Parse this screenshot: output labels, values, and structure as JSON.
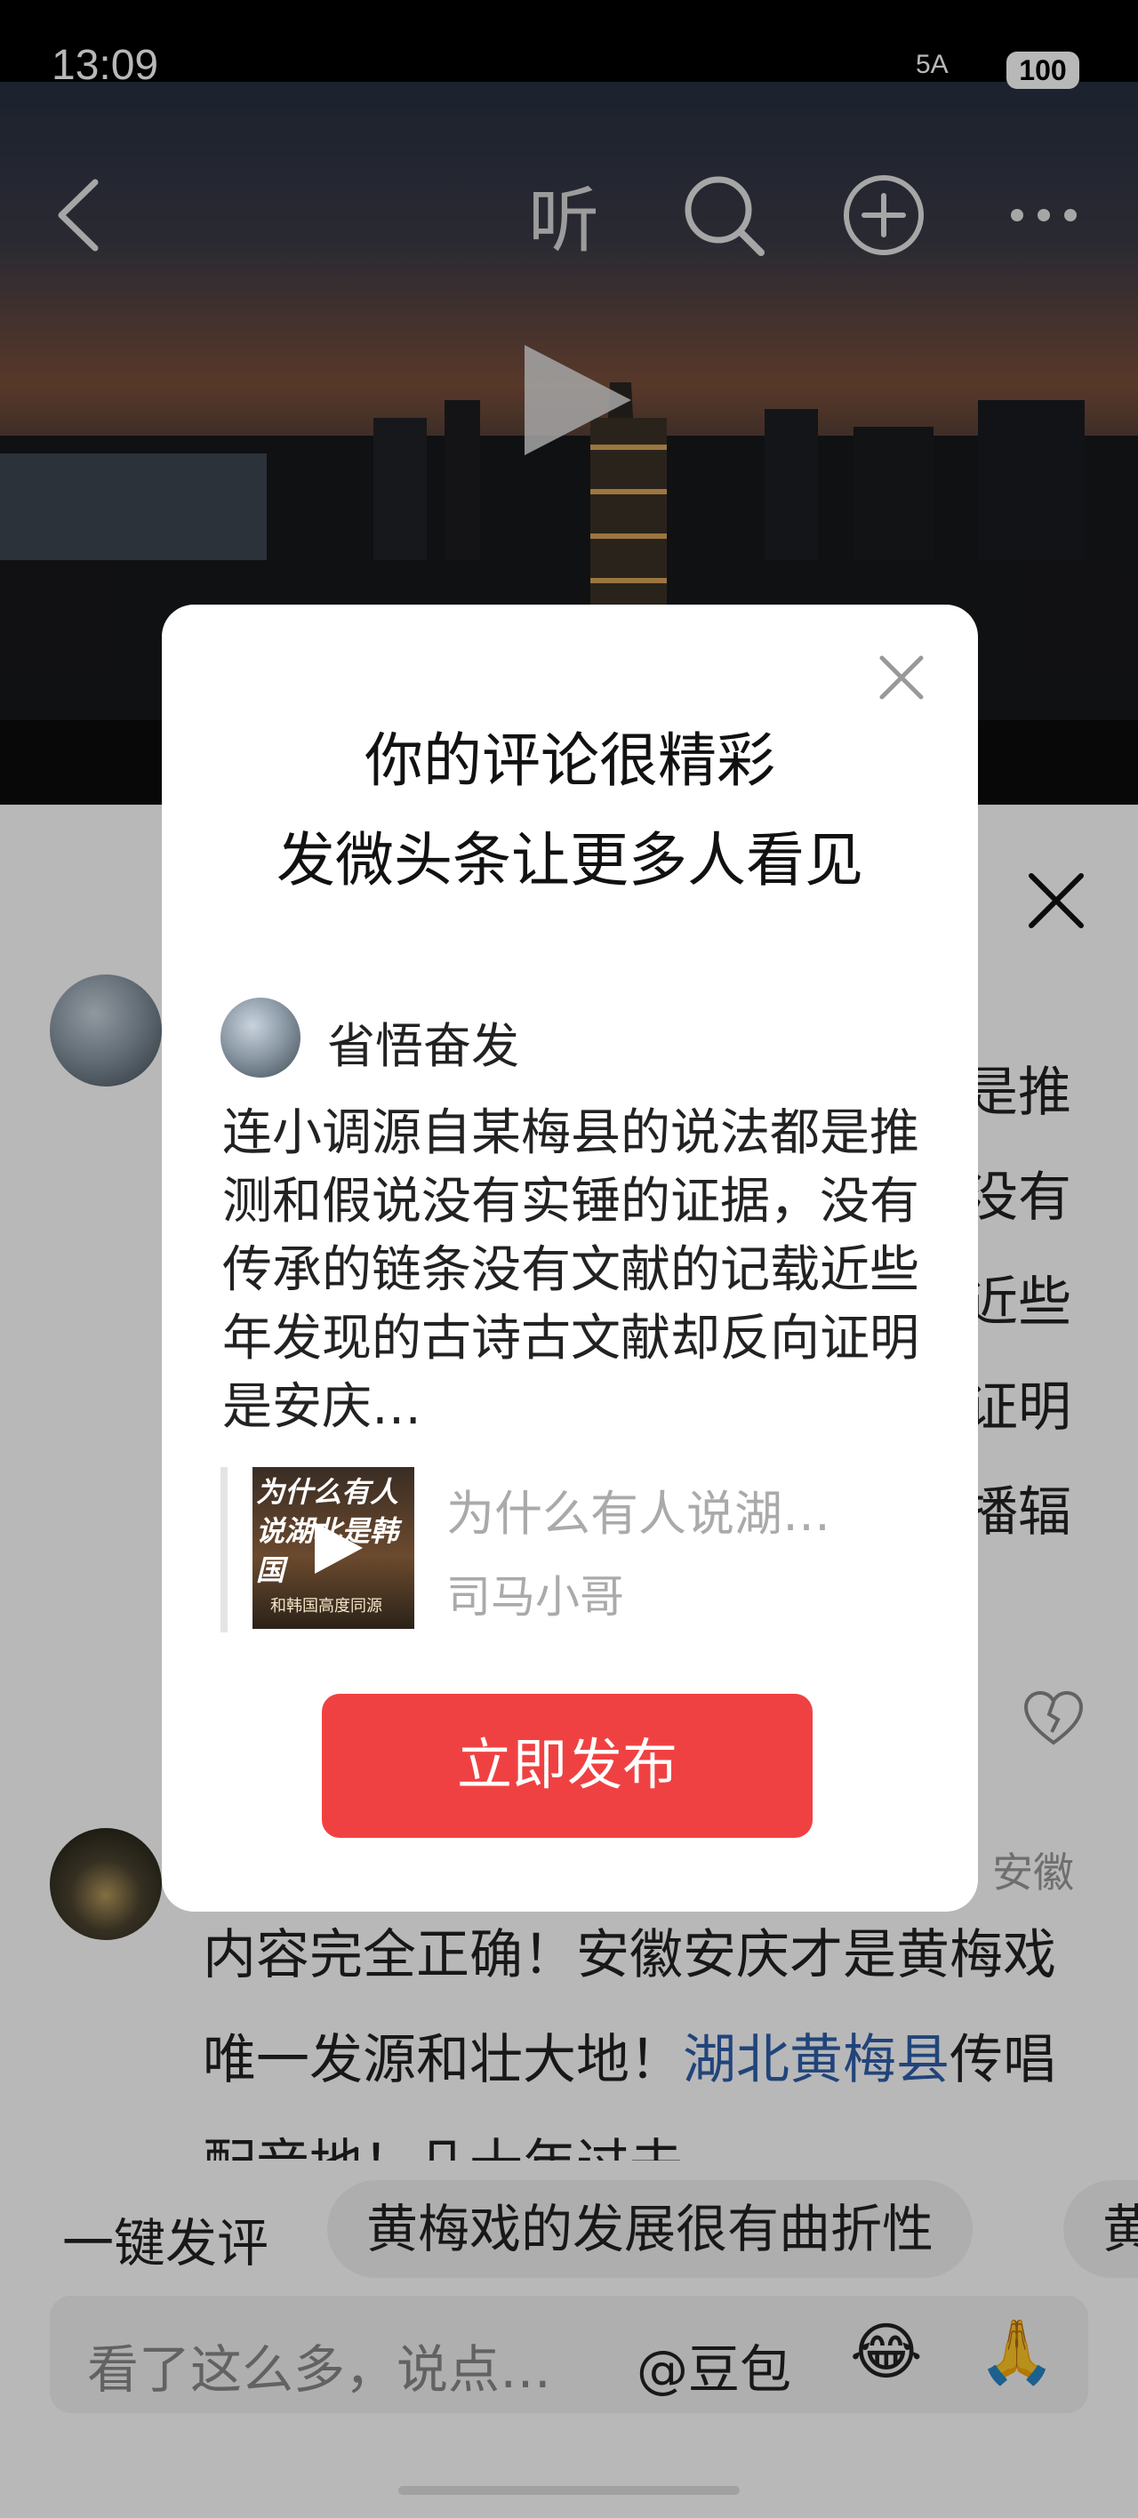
{
  "status_bar": {
    "time": "13:09",
    "signal": "5A",
    "battery": "100"
  },
  "top_bar": {
    "listen_label": "听"
  },
  "comment_panel": {
    "first_comment_visible_right": [
      "是推",
      "没有",
      "近些",
      "证明",
      "播辐"
    ],
    "second_comment": {
      "location": "安徽",
      "text_part1": "内容完全正确！安徽安庆才是黄梅戏唯一发源和壮大地！",
      "text_link": "湖北黄梅县",
      "text_part2": "传唱配音地！几十年过去"
    }
  },
  "quick_comment": {
    "label": "一键发评",
    "chips": [
      "黄梅戏的发展很有曲折性",
      "黄"
    ]
  },
  "input_bar": {
    "placeholder": "看了这么多，说点…",
    "mention": "@豆包",
    "emoji1": "😂",
    "emoji2": "🙏"
  },
  "dialog": {
    "title_line1": "你的评论很精彩",
    "title_line2": "发微头条让更多人看见",
    "username": "省悟奋发",
    "comment_text": "连小调源自某梅县的说法都是推测和假说没有实锤的证据，没有传承的链条没有文献的记载近些年发现的古诗古文献却反向证明是安庆…",
    "quote_title": "为什么有人说湖…",
    "quote_author": "司马小哥",
    "thumb_text": "为什么有人说湖北是韩国",
    "thumb_caption": "和韩国高度同源",
    "publish_label": "立即发布"
  },
  "colors": {
    "publish_button": "#f04142",
    "link": "#2f5fab"
  }
}
